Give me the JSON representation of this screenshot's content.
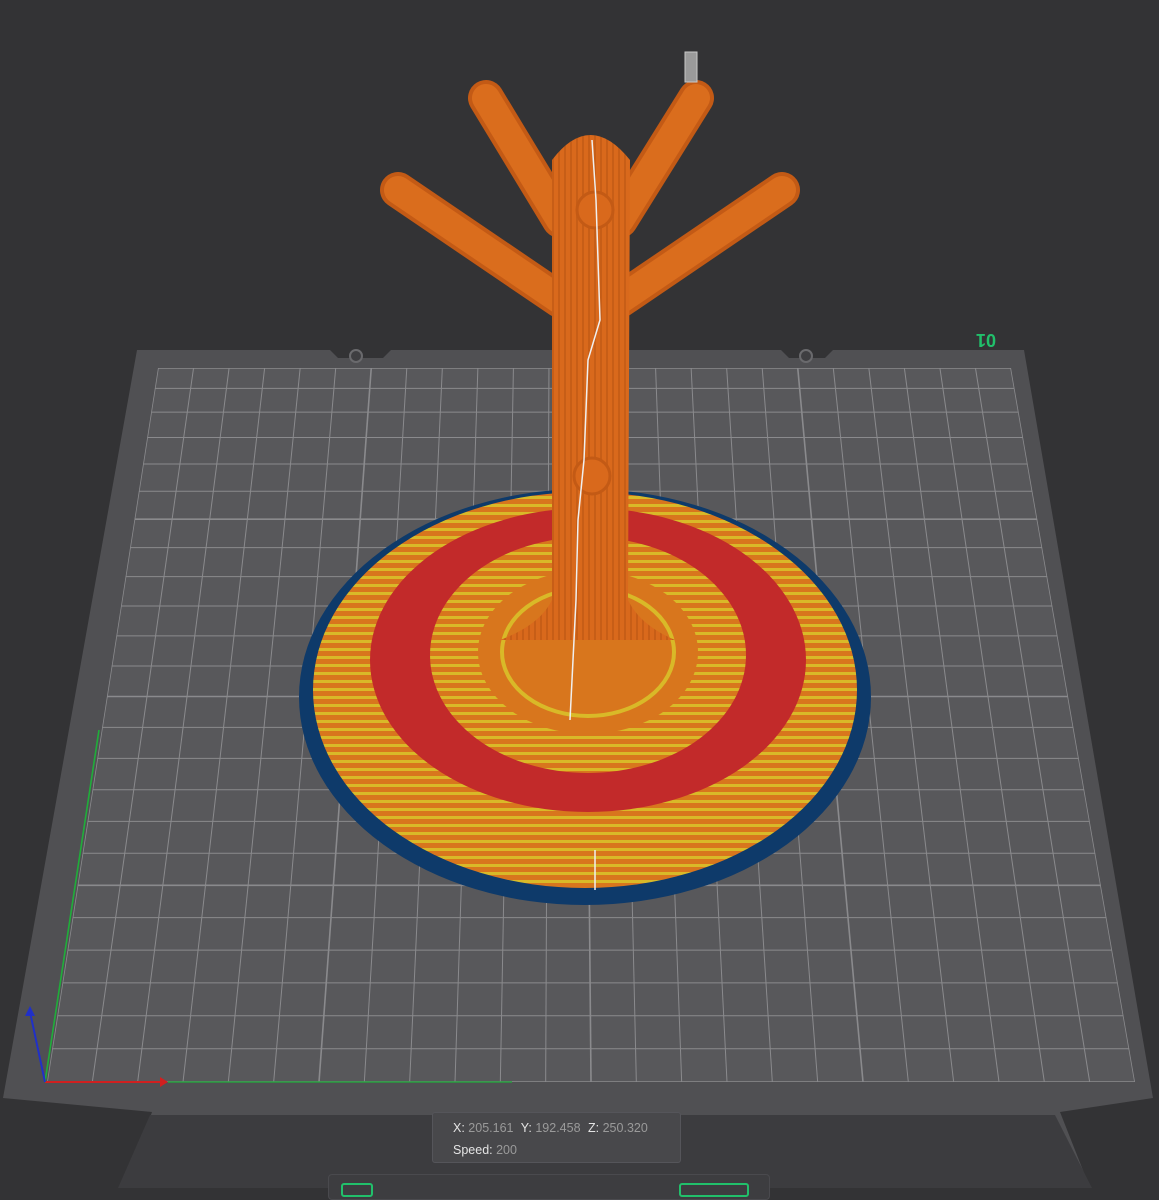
{
  "viewport": {
    "plate_label": "01",
    "colors": {
      "background": "#333335",
      "plate": "#505053",
      "grid": "#8a8a8d",
      "model_orange": "#d9691c",
      "model_yellow": "#d7c42a",
      "model_red": "#c22a2a",
      "brim_blue": "#0e3a6a",
      "axis_x": "#d02020",
      "axis_y": "#1fae3a",
      "axis_z": "#2030c8",
      "accent_green": "#21c06b"
    }
  },
  "position_readout": {
    "x_label": "X:",
    "x_value": "205.161",
    "y_label": "Y:",
    "y_value": "192.458",
    "z_label": "Z:",
    "z_value": "250.320",
    "speed_label": "Speed:",
    "speed_value": "200"
  }
}
